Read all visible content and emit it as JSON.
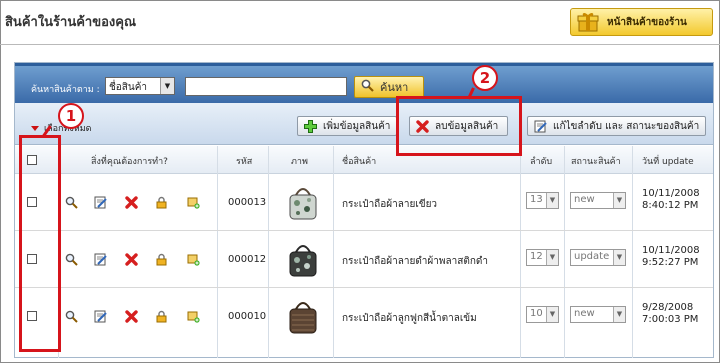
{
  "page": {
    "title": "สินค้าในร้านค้าของคุณ",
    "store_button": "หน้าสินค้าของร้าน"
  },
  "search": {
    "label": "ค้นหาสินค้าตาม :",
    "field_option": "ชื่อสินค้า",
    "input_value": "",
    "button": "ค้นหา"
  },
  "toolbar": {
    "select_all": "เลือกทั้งหมด",
    "add_button": "เพิ่มข้อมูลสินค้า",
    "delete_button": "ลบข้อมูลสินค้า",
    "edit_order_button": "แก้ไขลำดับ และ สถานะของสินค้า"
  },
  "table": {
    "headers": {
      "action": "สิ่งที่คุณต้องการทำ?",
      "code": "รหัส",
      "image": "ภาพ",
      "name": "ชื่อสินค้า",
      "order": "ลำดับ",
      "status": "สถานะสินค้า",
      "updated": "วันที่ update"
    },
    "rows": [
      {
        "code": "000013",
        "name": "กระเป๋าถือผ้าลายเขียว",
        "order": "13",
        "status": "new",
        "date": "10/11/2008",
        "time": "8:40:12 PM"
      },
      {
        "code": "000012",
        "name": "กระเป๋าถือผ้าลายดำผ้าพลาสติกดำ",
        "order": "12",
        "status": "update",
        "date": "10/11/2008",
        "time": "9:52:27 PM"
      },
      {
        "code": "000010",
        "name": "กระเป๋าถือผ้าลูกฟูกสีน้ำตาลเข้ม",
        "order": "10",
        "status": "new",
        "date": "9/28/2008",
        "time": "7:00:03 PM"
      }
    ]
  },
  "callouts": {
    "one": "1",
    "two": "2"
  },
  "colors": {
    "accent_red": "#d6141b",
    "header_blue": "#3a6aa8",
    "button_yellow": "#f0c22a"
  }
}
